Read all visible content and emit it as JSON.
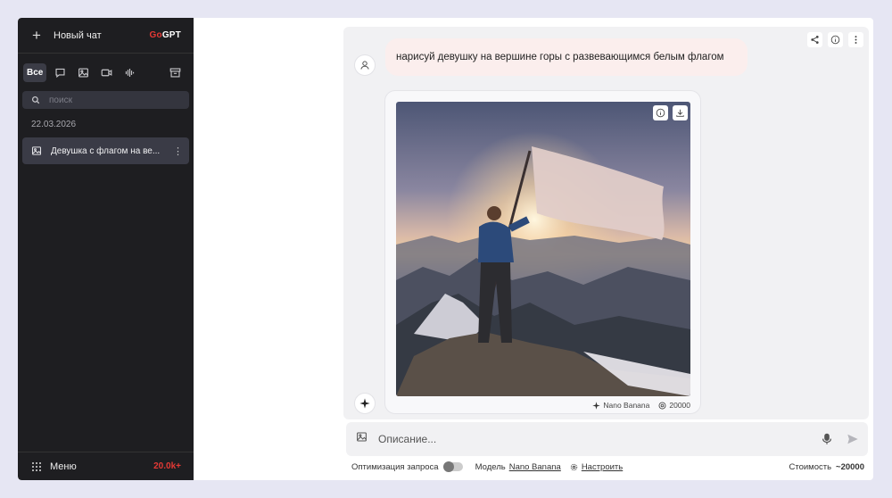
{
  "sidebar": {
    "new_chat_label": "Новый чат",
    "brand_go": "Go",
    "brand_gpt": "GPT",
    "filters": {
      "all_label": "Все",
      "icons": [
        "chat-icon",
        "image-icon",
        "video-icon",
        "audio-icon",
        "archive-icon"
      ]
    },
    "search_placeholder": "поиск",
    "date": "22.03.2026",
    "chats": [
      {
        "title": "Девушка с флагом на ве...",
        "icon": "image-icon"
      }
    ],
    "menu_label": "Меню",
    "tokens": "20.0k+"
  },
  "main": {
    "user_message": "нарисуй девушку на вершине горы с развевающимся белым флагом",
    "image": {
      "model_name": "Nano Banana",
      "cost": "20000"
    }
  },
  "composer": {
    "placeholder": "Описание...",
    "optimize_label": "Оптимизация запроса",
    "model_label": "Модель",
    "model_value": "Nano Banana",
    "settings_label": "Настроить",
    "cost_label": "Стоимость",
    "cost_value": "~20000"
  },
  "colors": {
    "accent": "#e53935",
    "sidebar_bg": "#1e1e21",
    "user_bubble": "#fbeeed",
    "page_bg": "#e6e6f3"
  }
}
